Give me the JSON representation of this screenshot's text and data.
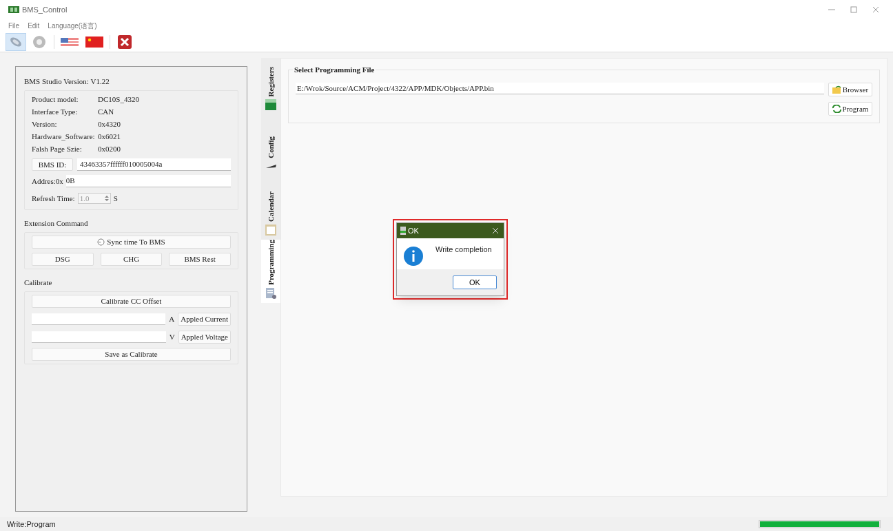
{
  "window": {
    "title": "BMS_Control"
  },
  "menu": [
    "File",
    "Edit",
    "Language(语言)"
  ],
  "toolbar": [
    {
      "kind": "connect",
      "selected": true
    },
    {
      "kind": "gear",
      "selected": false
    },
    {
      "kind": "us-flag",
      "selected": false
    },
    {
      "kind": "cn-flag",
      "selected": false
    },
    {
      "kind": "exit",
      "selected": false
    }
  ],
  "info": {
    "version": "BMS Studio Version: V1.22",
    "rows": [
      {
        "label": "Product model:",
        "value": "DC10S_4320"
      },
      {
        "label": "Interface Type:",
        "value": "CAN"
      },
      {
        "label": "Version:",
        "value": "0x4320"
      },
      {
        "label": "Hardware_Software:",
        "value": "0x6021"
      },
      {
        "label": "Falsh Page Szie:",
        "value": "0x0200"
      }
    ],
    "bms_id_button": "BMS ID:",
    "bms_id": "43463357ffffff010005004a",
    "address_label": "Addres:0x",
    "address": "0B",
    "refresh_label": "Refresh Time:",
    "refresh_value": "1.0",
    "refresh_unit": "S"
  },
  "extension": {
    "title": "Extension Command",
    "sync_button": "Sync time To BMS",
    "buttons": [
      "DSG",
      "CHG",
      "BMS Rest"
    ]
  },
  "calibrate": {
    "title": "Calibrate",
    "offset_button": "Calibrate CC Offset",
    "current_unit": "A",
    "current_button": "Appled Current",
    "voltage_unit": "V",
    "voltage_button": "Appled Voltage",
    "save_button": "Save as Calibrate"
  },
  "tabs": [
    {
      "label": "Registers",
      "kind": "registers",
      "selected": false
    },
    {
      "label": "Config",
      "kind": "config",
      "selected": false
    },
    {
      "label": "Calendar",
      "kind": "calendar",
      "selected": false
    },
    {
      "label": "Programming",
      "kind": "programming",
      "selected": true
    }
  ],
  "programming": {
    "title": "Select Programming File",
    "path": "E:/Wrok/Source/ACM/Project/4322/APP/MDK/Objects/APP.bin",
    "browse_button": "Browser",
    "program_button": "Program"
  },
  "dialog": {
    "title": "OK",
    "message": "Write completion",
    "button": "OK"
  },
  "status_bar": {
    "text": "Write:Program",
    "progress": {
      "level": 1
    }
  }
}
